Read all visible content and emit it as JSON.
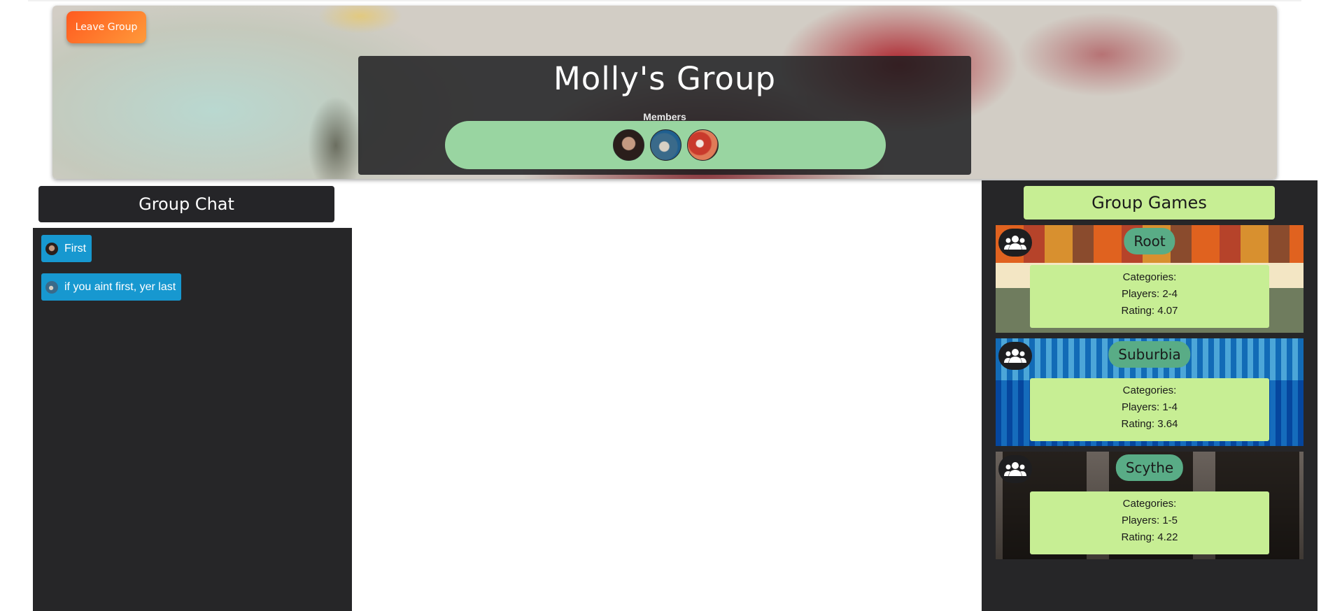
{
  "header": {
    "leave_button_label": "Leave Group",
    "group_name": "Molly's Group",
    "members_label": "Members",
    "members": [
      {
        "avatar_name": "member-avatar-1"
      },
      {
        "avatar_name": "member-avatar-2"
      },
      {
        "avatar_name": "member-avatar-3"
      }
    ]
  },
  "chat": {
    "title": "Group Chat",
    "messages": [
      {
        "text": "First"
      },
      {
        "text": "if you aint first, yer last"
      }
    ]
  },
  "games": {
    "title": "Group Games",
    "icon": "group-people-icon",
    "items": [
      {
        "name": "Root",
        "categories": "Categories:",
        "players": "Players: 2-4",
        "rating": "Rating: 4.07"
      },
      {
        "name": "Suburbia",
        "categories": "Categories:",
        "players": "Players: 1-4",
        "rating": "Rating: 3.64"
      },
      {
        "name": "Scythe",
        "categories": "Categories:",
        "players": "Players: 1-5",
        "rating": "Rating: 4.22"
      }
    ]
  },
  "colors": {
    "accent_green": "#99d5a1",
    "game_info_bg": "#c7ee94",
    "game_name_bg": "#59ac86",
    "chat_bubble": "#1798d0",
    "dark_panel": "#262628",
    "leave_button": "#ff7a2a"
  }
}
